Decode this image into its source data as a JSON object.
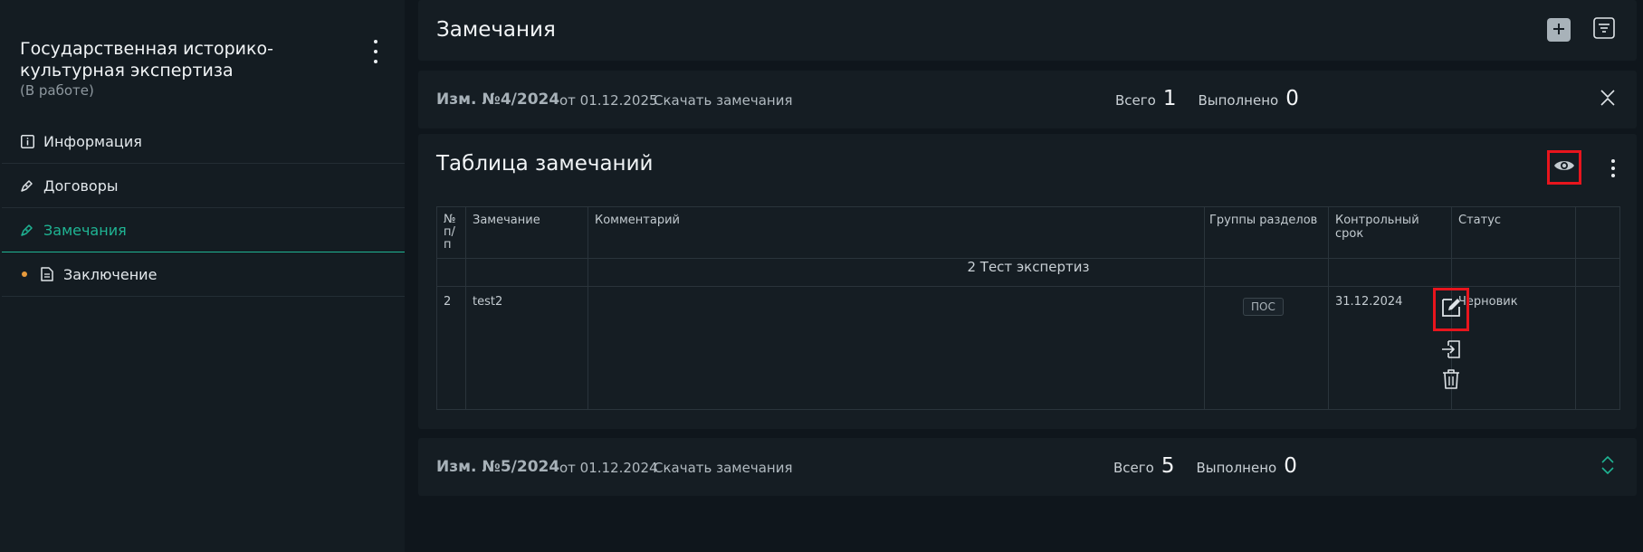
{
  "sidebar": {
    "project_title": "Государственная историко-культурная экспертиза",
    "project_status": "(В работе)",
    "items": [
      {
        "label": "Информация",
        "icon": "info-icon"
      },
      {
        "label": "Договоры",
        "icon": "pen-icon"
      },
      {
        "label": "Замечания",
        "icon": "pen-icon",
        "active": true
      },
      {
        "label": "Заключение",
        "icon": "document-icon"
      }
    ]
  },
  "header": {
    "title": "Замечания"
  },
  "revisions": [
    {
      "title": "Изм. №4/2024",
      "date": "от 01.12.2025",
      "download": "Скачать замечания",
      "total_label": "Всего",
      "total": "1",
      "done_label": "Выполнено",
      "done": "0"
    },
    {
      "title": "Изм. №5/2024",
      "date": "от 01.12.2024",
      "download": "Скачать замечания",
      "total_label": "Всего",
      "total": "5",
      "done_label": "Выполнено",
      "done": "0"
    }
  ],
  "table": {
    "title": "Таблица замечаний",
    "columns": [
      "№ п/п",
      "Замечание",
      "Комментарий",
      "Группы разделов",
      "Контрольный срок",
      "Статус"
    ],
    "group_label": "2 Тест экспертиз",
    "rows": [
      {
        "num": "2",
        "remark": "test2",
        "comment": "",
        "section_tag": "ПОС",
        "deadline": "31.12.2024",
        "status": "Черновик"
      }
    ]
  },
  "colors": {
    "accent": "#1fb493",
    "highlight": "#e8151d",
    "dot": "#e89a3c"
  }
}
